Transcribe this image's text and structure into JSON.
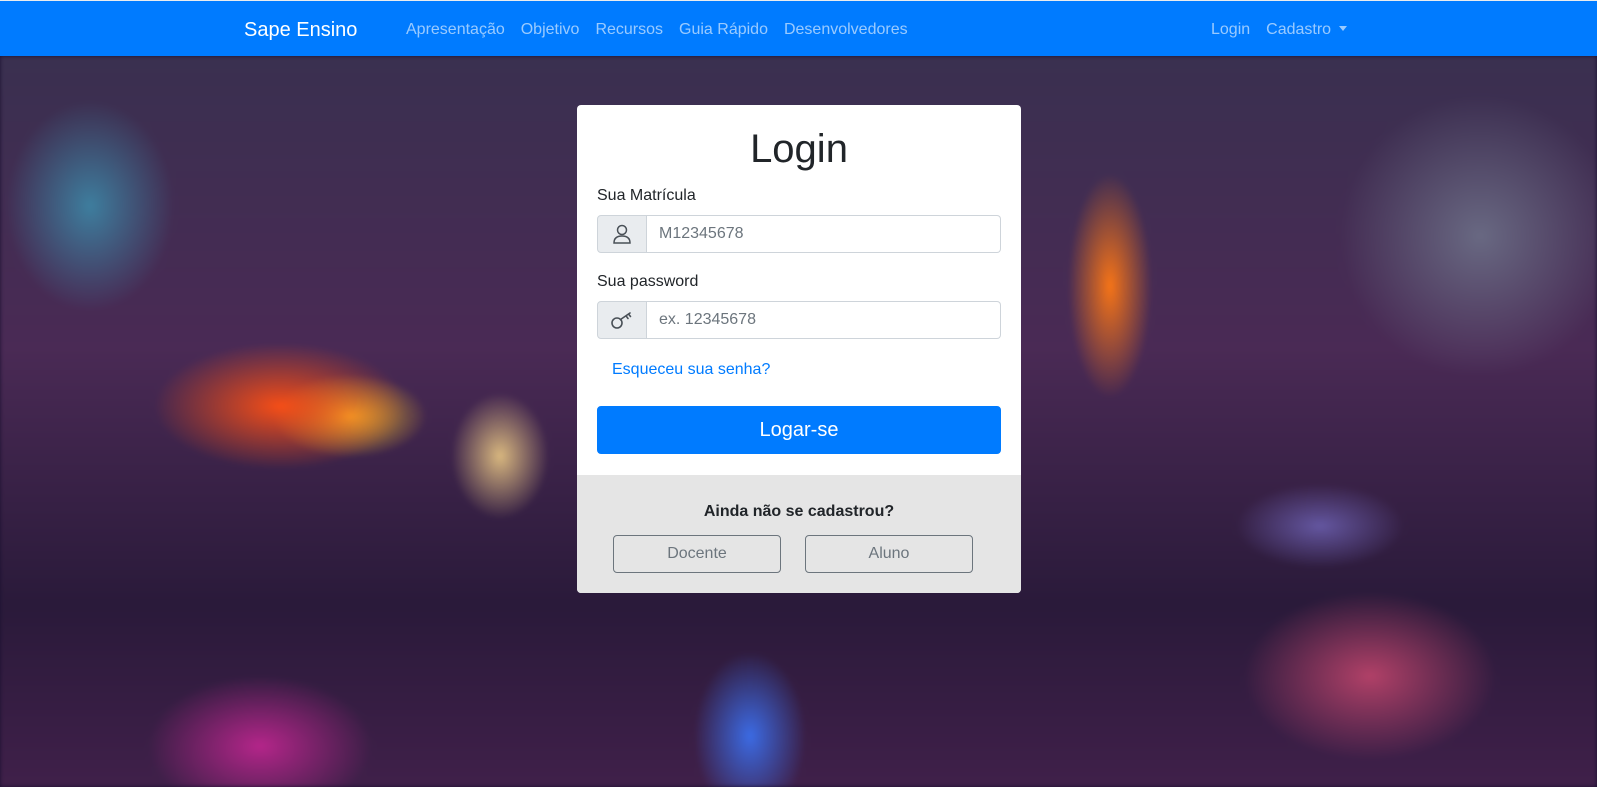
{
  "navbar": {
    "brand": "Sape Ensino",
    "links": [
      {
        "label": "Apresentação"
      },
      {
        "label": "Objetivo"
      },
      {
        "label": "Recursos"
      },
      {
        "label": "Guia Rápido"
      },
      {
        "label": "Desenvolvedores"
      }
    ],
    "right": {
      "login": "Login",
      "cadastro": "Cadastro"
    },
    "bg_color": "#007bff"
  },
  "login_card": {
    "title": "Login",
    "matricula": {
      "label": "Sua Matrícula",
      "placeholder": "M12345678",
      "value": "",
      "icon": "person-icon"
    },
    "password": {
      "label": "Sua password",
      "placeholder": "ex. 12345678",
      "value": "",
      "icon": "key-icon"
    },
    "forgot_link": "Esqueceu sua senha?",
    "submit_label": "Logar-se",
    "footer": {
      "title": "Ainda não se cadastrou?",
      "docente_label": "Docente",
      "aluno_label": "Aluno"
    }
  },
  "colors": {
    "primary": "#007bff",
    "footer_bg": "#e5e5e5",
    "outline": "#6c757d"
  }
}
